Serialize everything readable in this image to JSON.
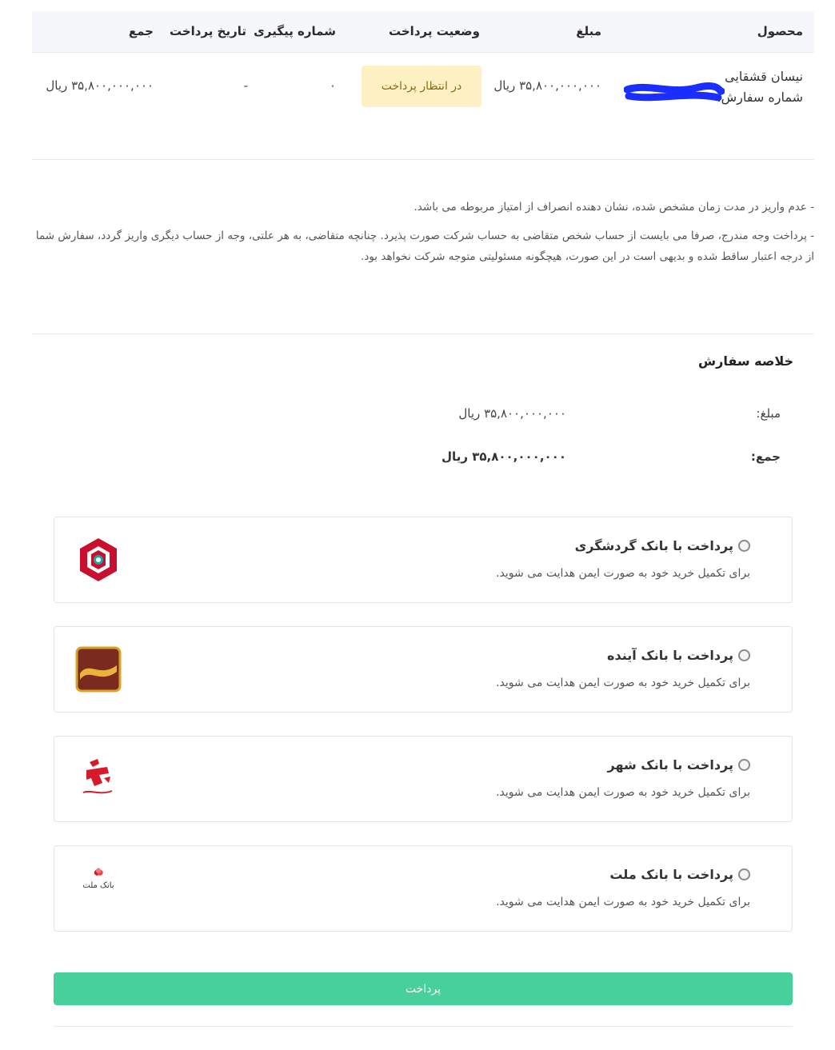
{
  "table": {
    "headers": {
      "product": "محصول",
      "amount": "مبلغ",
      "status": "وضعیت پرداخت",
      "tracking": "شماره پیگیری",
      "pay_date": "تاریخ پرداخت",
      "total": "جمع"
    },
    "row": {
      "product_name": "نیسان قشقایی",
      "order_number_label": "شماره سفارش:",
      "amount": "۳۵,۸۰۰,۰۰۰,۰۰۰ ریال",
      "status": "در انتظار پرداخت",
      "tracking": "۰",
      "pay_date": "-",
      "total": "۳۵,۸۰۰,۰۰۰,۰۰۰ ریال"
    }
  },
  "notes": {
    "line1": "- عدم واریز در مدت زمان مشخص شده، نشان دهنده انصراف از امتیاز مربوطه می باشد.",
    "line2": "- پرداخت وجه مندرج، صرفا می بایست از حساب شخص متقاضی به حساب شرکت صورت پذیرد. چنانچه متقاضی، به هر علتی، وجه از حساب دیگری واریز گردد، سفارش شما از درجه اعتبار ساقط شده و بدیهی است در این صورت، هیچگونه مسئولیتی متوجه شرکت نخواهد بود."
  },
  "summary": {
    "title": "خلاصه سفارش",
    "amount_label": "مبلغ:",
    "amount_value": "۳۵,۸۰۰,۰۰۰,۰۰۰ ریال",
    "total_label": "جمع:",
    "total_value": "۳۵,۸۰۰,۰۰۰,۰۰۰ ریال"
  },
  "banks": [
    {
      "title": "پرداخت با بانک گردشگری",
      "desc": "برای تکمیل خرید خود به صورت ایمن هدایت می شوید.",
      "logo": "gardeshgari-logo-icon"
    },
    {
      "title": "پرداخت با بانک آینده",
      "desc": "برای تکمیل خرید خود به صورت ایمن هدایت می شوید.",
      "logo": "ayandeh-logo-icon"
    },
    {
      "title": "پرداخت با بانک شهر",
      "desc": "برای تکمیل خرید خود به صورت ایمن هدایت می شوید.",
      "logo": "shahr-logo-icon"
    },
    {
      "title": "پرداخت با بانک ملت",
      "desc": "برای تکمیل خرید خود به صورت ایمن هدایت می شوید.",
      "logo": "mellat-logo-icon",
      "logo_text": "بانک ملت"
    }
  ],
  "pay_button_label": "پرداخت",
  "colors": {
    "accent": "#47d09c",
    "status_badge_bg": "#fdf1c4",
    "header_bg": "#f5f7fa",
    "redaction": "#1a2fff"
  }
}
